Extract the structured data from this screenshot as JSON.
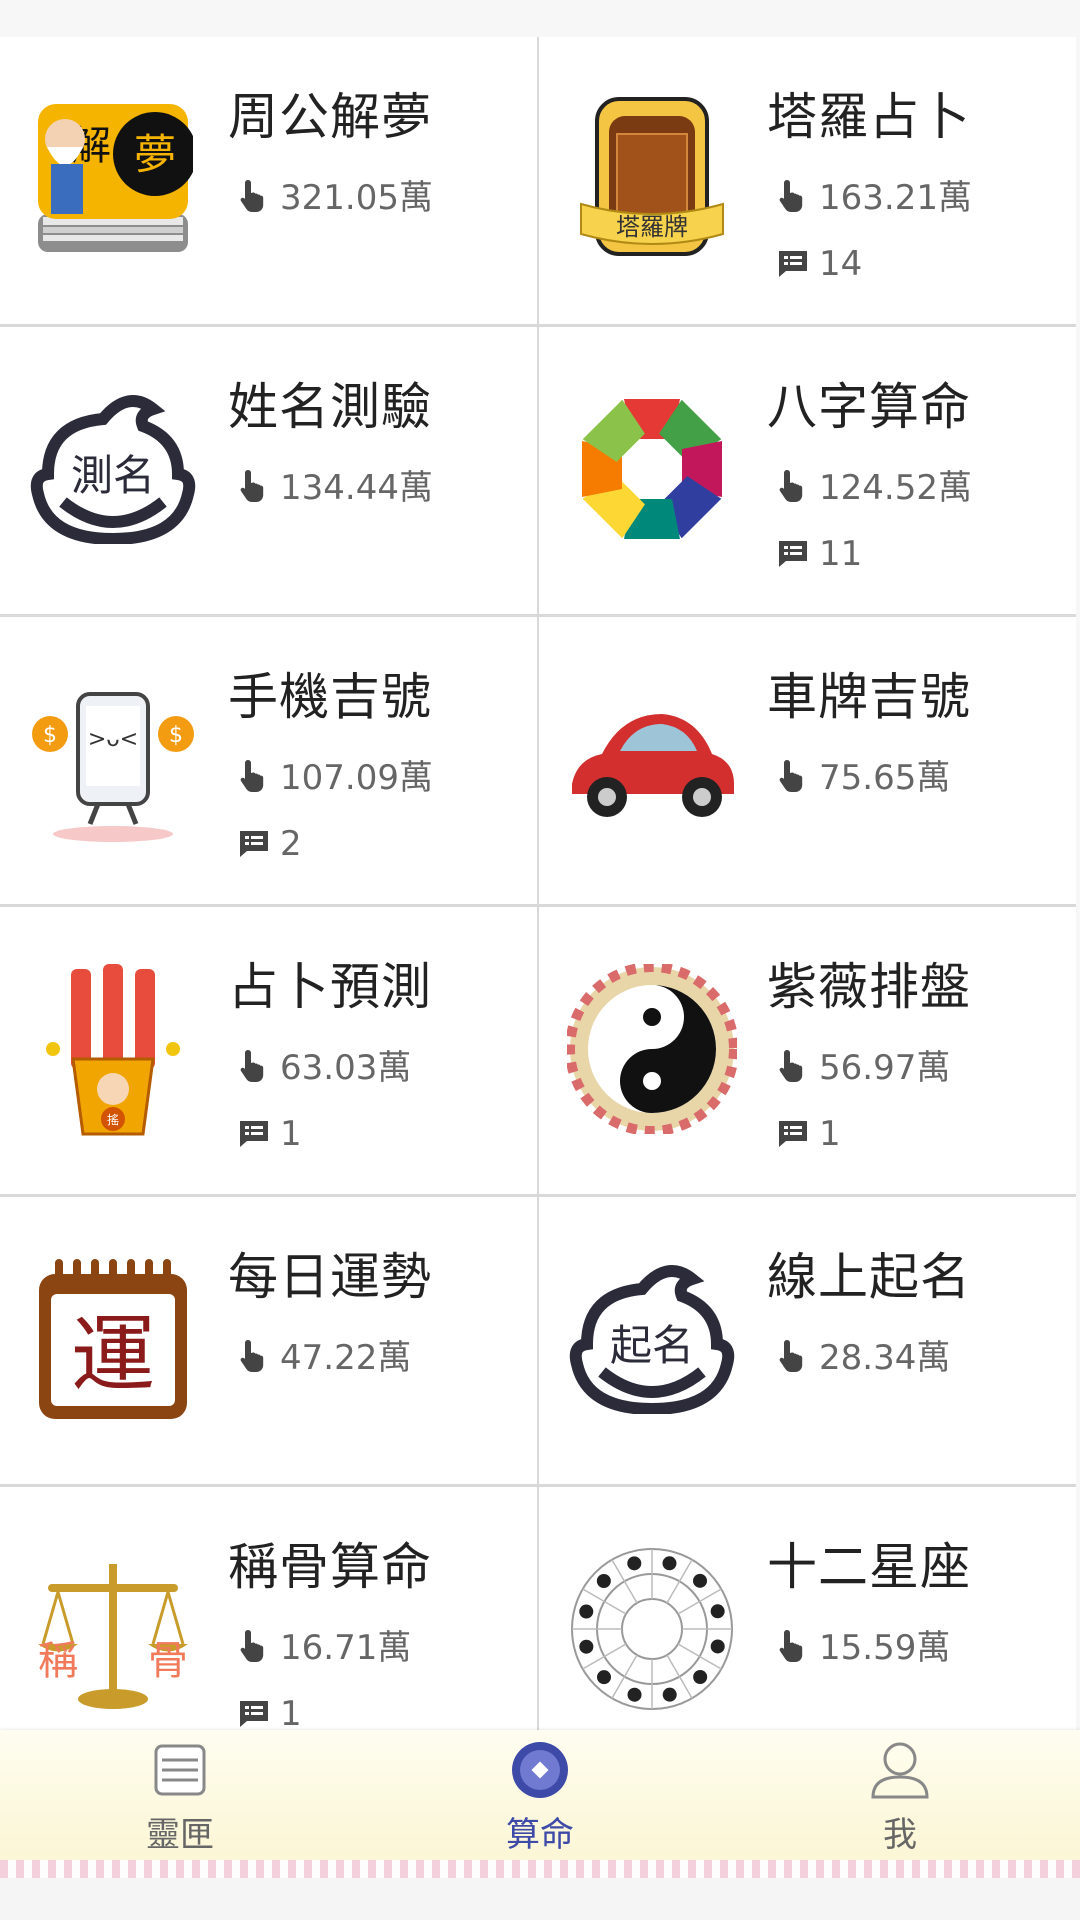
{
  "items": [
    {
      "title": "周公解夢",
      "views": "321.05萬",
      "comments": null,
      "icon": "dream-book-icon"
    },
    {
      "title": "塔羅占卜",
      "views": "163.21萬",
      "comments": "14",
      "icon": "tarot-card-icon"
    },
    {
      "title": "姓名測驗",
      "views": "134.44萬",
      "comments": null,
      "icon": "name-test-face-icon",
      "icon_text": "測名"
    },
    {
      "title": "八字算命",
      "views": "124.52萬",
      "comments": "11",
      "icon": "bagua-icon"
    },
    {
      "title": "手機吉號",
      "views": "107.09萬",
      "comments": "2",
      "icon": "phone-money-icon"
    },
    {
      "title": "車牌吉號",
      "views": "75.65萬",
      "comments": null,
      "icon": "red-car-icon"
    },
    {
      "title": "占卜預測",
      "views": "63.03萬",
      "comments": "1",
      "icon": "fortune-sticks-icon"
    },
    {
      "title": "紫薇排盤",
      "views": "56.97萬",
      "comments": "1",
      "icon": "yin-yang-icon"
    },
    {
      "title": "每日運勢",
      "views": "47.22萬",
      "comments": null,
      "icon": "calendar-luck-icon",
      "icon_text": "運"
    },
    {
      "title": "線上起名",
      "views": "28.34萬",
      "comments": null,
      "icon": "naming-face-icon",
      "icon_text": "起名"
    },
    {
      "title": "稱骨算命",
      "views": "16.71萬",
      "comments": "1",
      "icon": "scale-icon",
      "icon_text": "稱骨"
    },
    {
      "title": "十二星座",
      "views": "15.59萬",
      "comments": null,
      "icon": "zodiac-wheel-icon"
    }
  ],
  "nav": [
    {
      "label": "靈匣",
      "icon": "box-icon",
      "active": false
    },
    {
      "label": "算命",
      "icon": "fortune-coin-icon",
      "active": true
    },
    {
      "label": "我",
      "icon": "user-icon",
      "active": false
    }
  ],
  "colors": {
    "accent": "#3d4aa8",
    "muted": "#666666"
  }
}
